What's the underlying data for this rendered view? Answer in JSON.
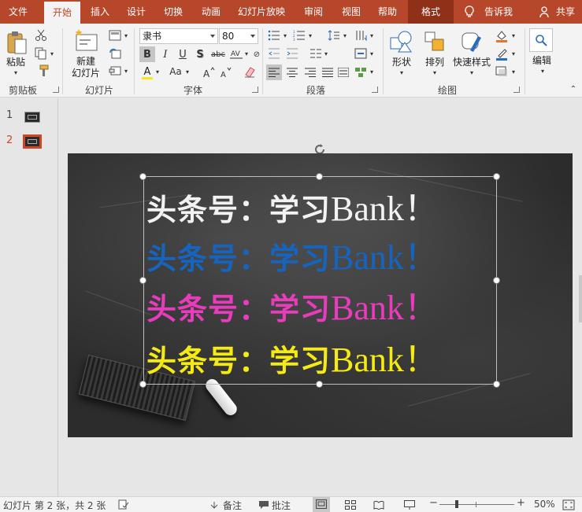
{
  "tabs": {
    "file": "文件",
    "home": "开始",
    "insert": "插入",
    "design": "设计",
    "transitions": "切换",
    "animations": "动画",
    "slideshow": "幻灯片放映",
    "review": "审阅",
    "view": "视图",
    "help": "帮助",
    "format": "格式",
    "tell_me": "告诉我",
    "share": "共享"
  },
  "ribbon": {
    "clipboard": {
      "paste": "粘贴",
      "group": "剪贴板"
    },
    "slides": {
      "new_slide_line1": "新建",
      "new_slide_line2": "幻灯片",
      "group": "幻灯片"
    },
    "font": {
      "font_name": "隶书",
      "font_size": "80",
      "group": "字体",
      "bold": "B",
      "italic": "I",
      "underline": "U",
      "shadow": "S",
      "strike": "abc",
      "font_color": "A",
      "change_case": "Aa"
    },
    "paragraph": {
      "group": "段落"
    },
    "drawing": {
      "shapes": "形状",
      "arrange": "排列",
      "quick_styles": "快速样式",
      "group": "绘图"
    },
    "editing": {
      "label": "编辑"
    }
  },
  "thumbnails": [
    {
      "number": "1"
    },
    {
      "number": "2"
    }
  ],
  "slide": {
    "lines": [
      {
        "cn": "头条号：学习",
        "en": "Bank！",
        "color": "#f2f2f2"
      },
      {
        "cn": "头条号：学习",
        "en": "Bank！",
        "color": "#1565c0"
      },
      {
        "cn": "头条号：学习",
        "en": "Bank！",
        "color": "#e83cbc"
      },
      {
        "cn": "头条号：学习",
        "en": "Bank！",
        "color": "#f5ea14"
      }
    ]
  },
  "status": {
    "slide_info": "幻灯片 第 2 张，共 2 张",
    "notes": "备注",
    "comments": "批注",
    "zoom": "50%",
    "minus": "−",
    "plus": "+"
  },
  "colors": {
    "accent": "#b7472a",
    "format_tab": "#8f3018"
  }
}
